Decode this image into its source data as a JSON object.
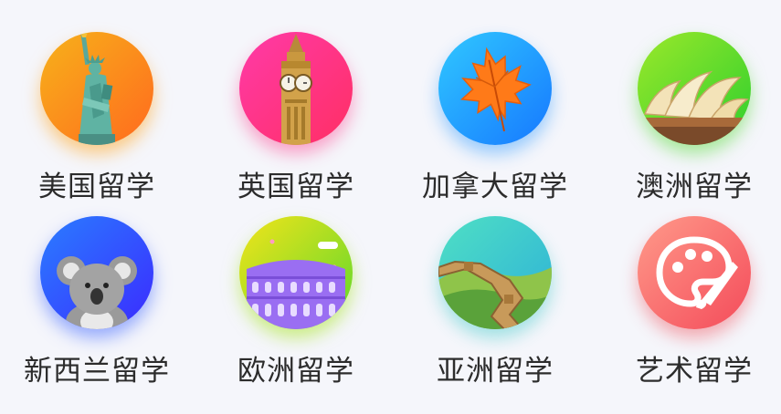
{
  "categories": [
    {
      "label": "美国留学",
      "icon": "statue-of-liberty-icon",
      "colors": [
        "#f7b21a",
        "#ff6a1e"
      ],
      "shadow": "rgba(255,168,40,0.55)"
    },
    {
      "label": "英国留学",
      "icon": "big-ben-icon",
      "colors": [
        "#ff3aa8",
        "#ff2f64"
      ],
      "shadow": "rgba(255,60,140,0.45)"
    },
    {
      "label": "加拿大留学",
      "icon": "maple-leaf-icon",
      "colors": [
        "#30c8ff",
        "#1678ff"
      ],
      "shadow": "rgba(40,150,255,0.45)"
    },
    {
      "label": "澳洲留学",
      "icon": "sydney-opera-house-icon",
      "colors": [
        "#9be82a",
        "#2ecf2e"
      ],
      "shadow": "rgba(90,220,60,0.5)"
    },
    {
      "label": "新西兰留学",
      "icon": "koala-icon",
      "colors": [
        "#2a7dff",
        "#3b2bff"
      ],
      "shadow": "rgba(60,100,255,0.5)"
    },
    {
      "label": "欧洲留学",
      "icon": "colosseum-icon",
      "colors": [
        "#f3e41a",
        "#5dd82c"
      ],
      "shadow": "rgba(170,230,40,0.55)"
    },
    {
      "label": "亚洲留学",
      "icon": "great-wall-icon",
      "colors": [
        "#4fe0c4",
        "#2db0d8"
      ],
      "shadow": "rgba(60,200,200,0.45)"
    },
    {
      "label": "艺术留学",
      "icon": "palette-brush-icon",
      "colors": [
        "#ff9a8a",
        "#f44b5a"
      ],
      "shadow": "rgba(240,80,90,0.45)"
    }
  ]
}
